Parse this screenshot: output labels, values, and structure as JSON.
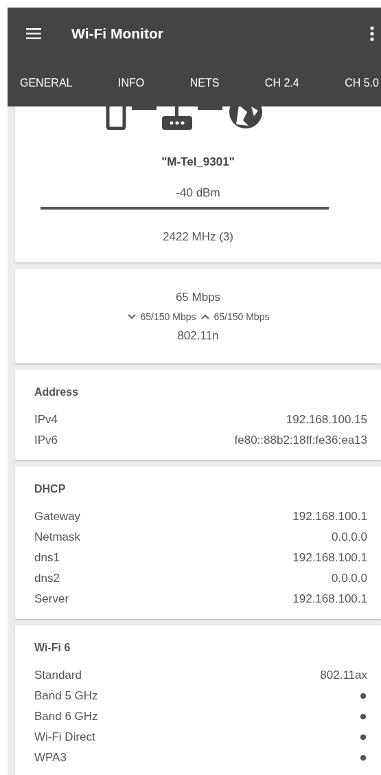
{
  "app_bar": {
    "title": "Wi-Fi Monitor"
  },
  "tabs": [
    {
      "label": "GENERAL"
    },
    {
      "label": "INFO"
    },
    {
      "label": "NETS"
    },
    {
      "label": "CH 2.4"
    },
    {
      "label": "CH 5.0"
    }
  ],
  "connection": {
    "ssid": "\"M-Tel_9301\"",
    "signal": "-40 dBm",
    "level": 1,
    "frequency": "2422 MHz (3)"
  },
  "speed": {
    "link_speed": "65 Mbps",
    "rx": "65/150 Mbps",
    "tx": "65/150 Mbps",
    "standard": "802.11n"
  },
  "sections": [
    {
      "title": "Address",
      "rows": [
        {
          "label": "IPv4",
          "kind": "text",
          "value": "192.168.100.15"
        },
        {
          "label": "IPv6",
          "kind": "text",
          "value": "fe80::88b2:18ff:fe36:ea13"
        }
      ]
    },
    {
      "title": "DHCP",
      "rows": [
        {
          "label": "Gateway",
          "kind": "text",
          "value": "192.168.100.1"
        },
        {
          "label": "Netmask",
          "kind": "text",
          "value": "0.0.0.0"
        },
        {
          "label": "dns1",
          "kind": "text",
          "value": "192.168.100.1"
        },
        {
          "label": "dns2",
          "kind": "text",
          "value": "0.0.0.0"
        },
        {
          "label": "Server",
          "kind": "text",
          "value": "192.168.100.1"
        }
      ]
    },
    {
      "title": "Wi-Fi 6",
      "rows": [
        {
          "label": "Standard",
          "kind": "text",
          "value": "802.11ax"
        },
        {
          "label": "Band 5 GHz",
          "kind": "dot"
        },
        {
          "label": "Band 6 GHz",
          "kind": "dot"
        },
        {
          "label": "Wi-Fi Direct",
          "kind": "dot"
        },
        {
          "label": "WPA3",
          "kind": "dot"
        }
      ]
    }
  ]
}
